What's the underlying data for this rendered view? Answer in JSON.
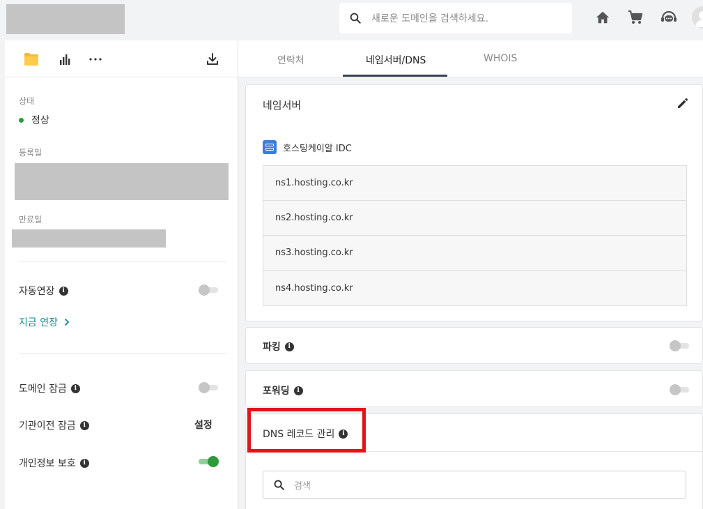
{
  "header": {
    "search_placeholder": "새로운 도메인을 검색하세요.",
    "icons": [
      "home-icon",
      "cart-icon",
      "support-chat-icon",
      "user-avatar"
    ]
  },
  "left_panel": {
    "toolbar_icons": [
      "folder-icon",
      "stats-icon",
      "more-icon",
      "download-icon"
    ],
    "status_label": "상태",
    "status_value": "정상",
    "registered_label": "등록일",
    "expiry_label": "만료일",
    "auto_renew_label": "자동연장",
    "auto_renew_on": false,
    "renew_now_label": "지금 연장",
    "domain_lock_label": "도메인 잠금",
    "domain_lock_on": false,
    "transfer_lock_label": "기관이전 잠금",
    "transfer_lock_action": "설정",
    "privacy_label": "개인정보 보호",
    "privacy_on": true
  },
  "tabs": [
    {
      "label": "연락처",
      "active": false
    },
    {
      "label": "네임서버/DNS",
      "active": true
    },
    {
      "label": "WHOIS",
      "active": false
    }
  ],
  "nameserver_card": {
    "title": "네임서버",
    "provider": "호스팅케이알 IDC",
    "servers": [
      "ns1.hosting.co.kr",
      "ns2.hosting.co.kr",
      "ns3.hosting.co.kr",
      "ns4.hosting.co.kr"
    ]
  },
  "parking_card": {
    "title": "파킹",
    "enabled": false
  },
  "forwarding_card": {
    "title": "포워딩",
    "enabled": false
  },
  "dns_card": {
    "title": "DNS 레코드 관리",
    "search_placeholder": "검색"
  },
  "colors": {
    "accent_teal": "#11868f",
    "status_green": "#2e9a3e",
    "highlight_red": "#e8121a"
  }
}
